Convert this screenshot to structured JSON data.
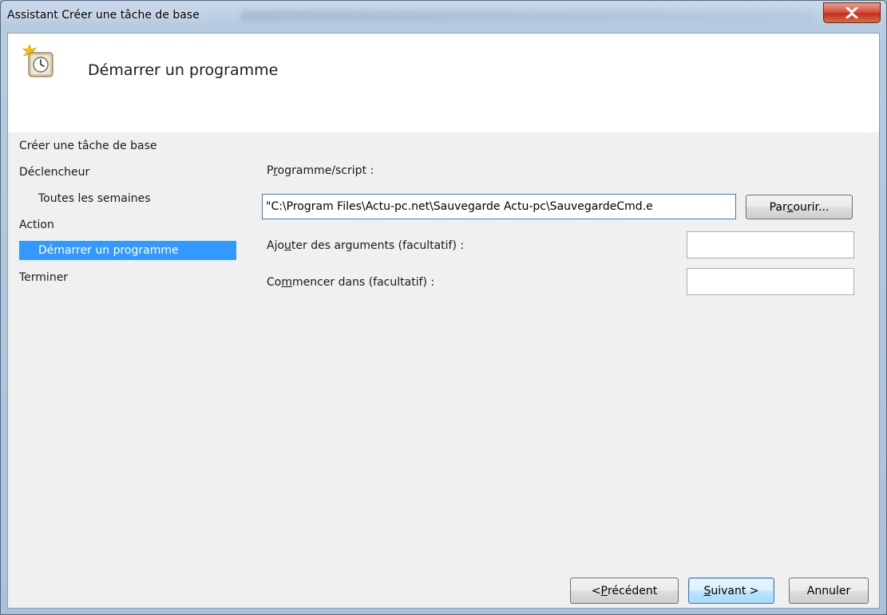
{
  "window": {
    "title": "Assistant Créer une tâche de base"
  },
  "header": {
    "title": "Démarrer un programme",
    "icon": "task-clock-icon"
  },
  "sidebar": {
    "items": [
      {
        "label": "Créer une tâche de base"
      },
      {
        "label": "Déclencheur"
      },
      {
        "label": "Toutes les semaines"
      },
      {
        "label": "Action"
      },
      {
        "label": "Démarrer un programme"
      },
      {
        "label": "Terminer"
      }
    ],
    "selected_color": "#3399ff"
  },
  "form": {
    "program_label_pre": "P",
    "program_label_u": "r",
    "program_label_post": "ogramme/script :",
    "program_value": "\"C:\\Program Files\\Actu-pc.net\\Sauvegarde Actu-pc\\SauvegardeCmd.e",
    "browse_pre": "Par",
    "browse_u": "c",
    "browse_post": "ourir...",
    "args_label_pre": "Ajo",
    "args_label_u": "u",
    "args_label_post": "ter des arguments (facultatif) :",
    "args_value": "",
    "start_label_pre": "Co",
    "start_label_u": "m",
    "start_label_post": "mencer dans (facultatif) :",
    "start_value": ""
  },
  "footer": {
    "prev_pre": "< ",
    "prev_u": "P",
    "prev_post": "récédent",
    "next_u": "S",
    "next_post": "uivant >",
    "cancel": "Annuler"
  }
}
